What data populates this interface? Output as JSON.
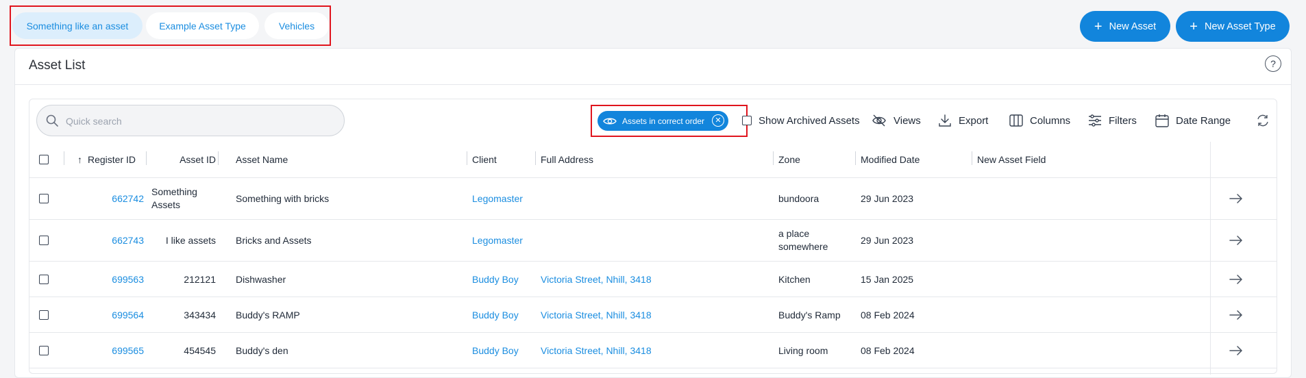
{
  "tabs": [
    {
      "label": "Something like an asset",
      "active": true
    },
    {
      "label": "Example Asset Type",
      "active": false
    },
    {
      "label": "Vehicles",
      "active": false
    }
  ],
  "actions": {
    "new_asset": "New Asset",
    "new_asset_type": "New Asset Type"
  },
  "card": {
    "title": "Asset List",
    "help": "?"
  },
  "search": {
    "placeholder": "Quick search"
  },
  "filter_chip": {
    "label": "Assets in correct order"
  },
  "toolbar": {
    "show_archived": "Show Archived Assets",
    "views": "Views",
    "export": "Export",
    "columns": "Columns",
    "filters": "Filters",
    "date_range": "Date Range"
  },
  "table": {
    "columns": [
      "Register ID",
      "Asset ID",
      "Asset Name",
      "Client",
      "Full Address",
      "Zone",
      "Modified Date",
      "New Asset Field"
    ],
    "rows": [
      {
        "register_id": "662742",
        "asset_id": "Something Assets",
        "asset_name": "Something with bricks",
        "client": "Legomaster",
        "address": "",
        "zone": "bundoora",
        "modified": "29 Jun 2023",
        "new_field": ""
      },
      {
        "register_id": "662743",
        "asset_id": "I like assets",
        "asset_name": "Bricks and Assets",
        "client": "Legomaster",
        "address": "",
        "zone": "a place somewhere",
        "modified": "29 Jun 2023",
        "new_field": ""
      },
      {
        "register_id": "699563",
        "asset_id": "212121",
        "asset_name": "Dishwasher",
        "client": "Buddy Boy",
        "address": "Victoria Street, Nhill, 3418",
        "zone": "Kitchen",
        "modified": "15 Jan 2025",
        "new_field": ""
      },
      {
        "register_id": "699564",
        "asset_id": "343434",
        "asset_name": "Buddy's RAMP",
        "client": "Buddy Boy",
        "address": "Victoria Street, Nhill, 3418",
        "zone": "Buddy's Ramp",
        "modified": "08 Feb 2024",
        "new_field": ""
      },
      {
        "register_id": "699565",
        "asset_id": "454545",
        "asset_name": "Buddy's den",
        "client": "Buddy Boy",
        "address": "Victoria Street, Nhill, 3418",
        "zone": "Living room",
        "modified": "08 Feb 2024",
        "new_field": ""
      }
    ]
  }
}
